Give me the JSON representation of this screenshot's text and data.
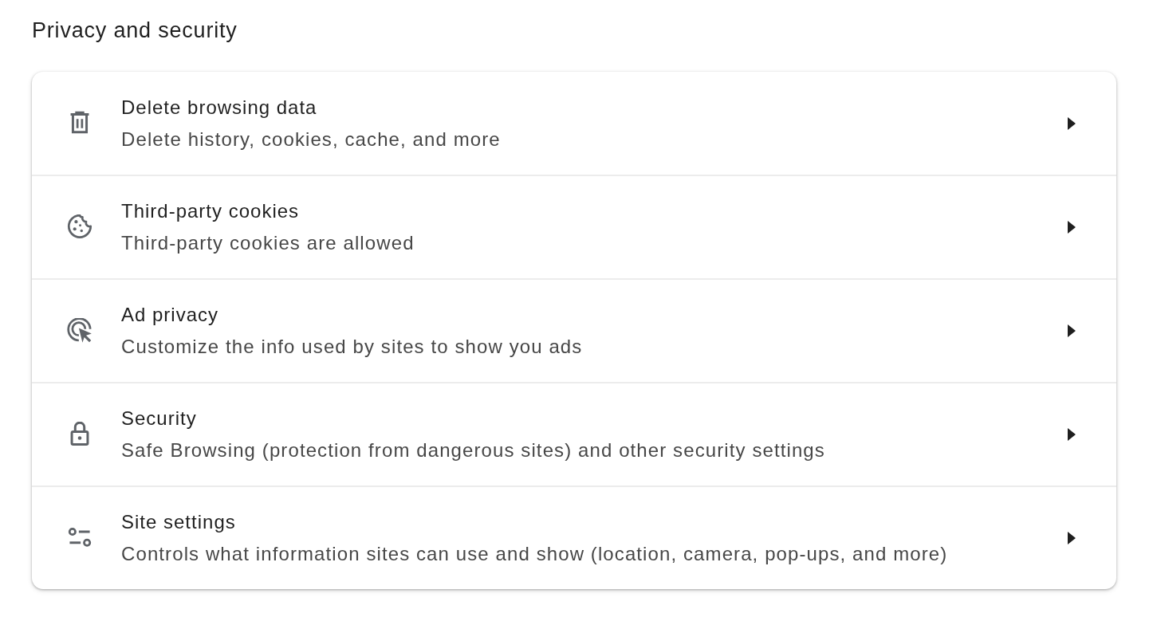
{
  "section": {
    "title": "Privacy and security"
  },
  "items": [
    {
      "title": "Delete browsing data",
      "subtitle": "Delete history, cookies, cache, and more"
    },
    {
      "title": "Third-party cookies",
      "subtitle": "Third-party cookies are allowed"
    },
    {
      "title": "Ad privacy",
      "subtitle": "Customize the info used by sites to show you ads"
    },
    {
      "title": "Security",
      "subtitle": "Safe Browsing (protection from dangerous sites) and other security settings"
    },
    {
      "title": "Site settings",
      "subtitle": "Controls what information sites can use and show (location, camera, pop-ups, and more)"
    }
  ]
}
